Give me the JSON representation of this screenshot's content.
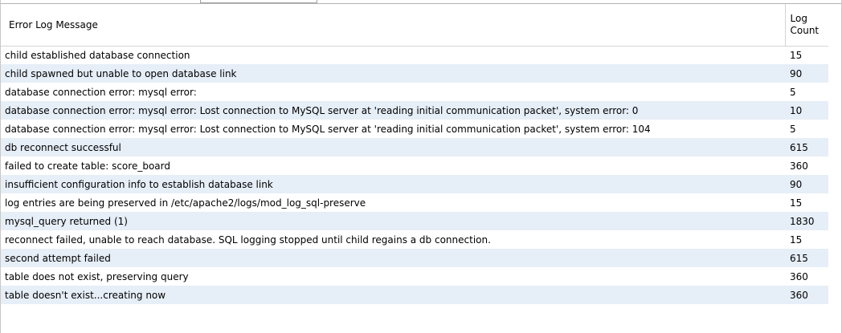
{
  "table": {
    "headers": {
      "message": "Error Log Message",
      "count_line1": "Log",
      "count_line2": "Count"
    },
    "rows": [
      {
        "message": "child established database connection",
        "count": "15"
      },
      {
        "message": "child spawned but unable to open database link",
        "count": "90"
      },
      {
        "message": "database connection error: mysql error:",
        "count": "5"
      },
      {
        "message": "database connection error: mysql error: Lost connection to MySQL server at 'reading initial communication packet', system error: 0",
        "count": "10"
      },
      {
        "message": "database connection error: mysql error: Lost connection to MySQL server at 'reading initial communication packet', system error: 104",
        "count": "5"
      },
      {
        "message": "db reconnect successful",
        "count": "615"
      },
      {
        "message": "failed to create table: score_board",
        "count": "360"
      },
      {
        "message": "insufficient configuration info to establish database link",
        "count": "90"
      },
      {
        "message": "log entries are being preserved in /etc/apache2/logs/mod_log_sql-preserve",
        "count": "15"
      },
      {
        "message": "mysql_query returned (1)",
        "count": "1830"
      },
      {
        "message": "reconnect failed, unable to reach database. SQL logging stopped until child regains a db connection.",
        "count": "15"
      },
      {
        "message": "second attempt failed",
        "count": "615"
      },
      {
        "message": "table does not exist, preserving query",
        "count": "360"
      },
      {
        "message": "table doesn't exist...creating now",
        "count": "360"
      }
    ]
  },
  "colors": {
    "alt_row": "#e6eef7",
    "grid_line": "#d4d4d4",
    "background": "#ffffff"
  }
}
